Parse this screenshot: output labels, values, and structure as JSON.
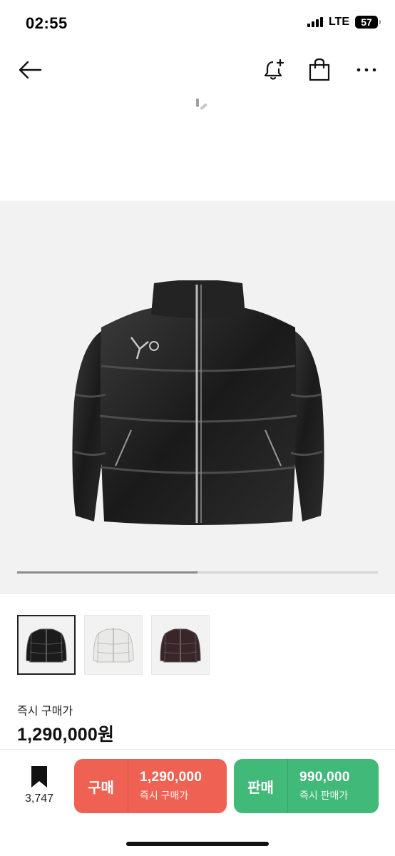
{
  "status_bar": {
    "time": "02:55",
    "network": "LTE",
    "battery": "57"
  },
  "nav": {
    "icons": [
      "back-arrow-icon",
      "bell-plus-icon",
      "shopping-bag-icon",
      "more-icon"
    ]
  },
  "product": {
    "image_label": "black leather puffer jacket",
    "carousel_progress": 0.5,
    "thumbnails": [
      {
        "color": "#1b1b1b",
        "selected": true
      },
      {
        "color": "#e9e9e7",
        "selected": false
      },
      {
        "color": "#3a2628",
        "selected": false
      }
    ]
  },
  "price": {
    "label": "즉시 구매가",
    "value": "1,290,000원"
  },
  "bottom_bar": {
    "bookmark_count": "3,747",
    "buy": {
      "tag": "구매",
      "price": "1,290,000",
      "sub": "즉시 구매가",
      "color": "#ef6253"
    },
    "sell": {
      "tag": "판매",
      "price": "990,000",
      "sub": "즉시 판매가",
      "color": "#41b979"
    }
  }
}
